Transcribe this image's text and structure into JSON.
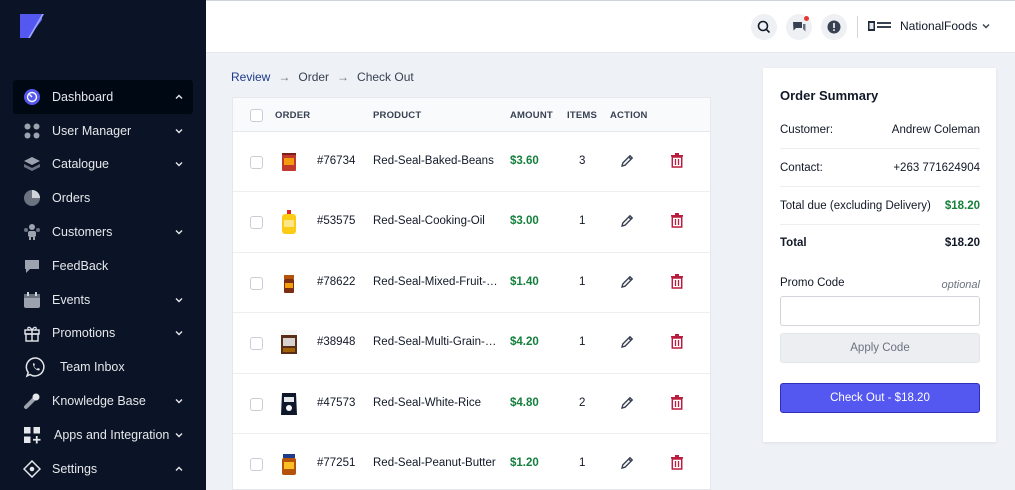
{
  "colors": {
    "sidebar_bg": "#0b1426",
    "accent": "#5457f0",
    "amount_green": "#15803d",
    "delete_red": "#b91c3c"
  },
  "sidebar": {
    "logo": "app-logo-icon",
    "items": [
      {
        "label": "Dashboard",
        "icon": "dashboard-icon",
        "chevron": "up",
        "active": true
      },
      {
        "label": "User Manager",
        "icon": "user-manager-icon",
        "chevron": "down"
      },
      {
        "label": "Catalogue",
        "icon": "catalogue-icon",
        "chevron": "down"
      },
      {
        "label": "Orders",
        "icon": "orders-icon",
        "chevron": ""
      },
      {
        "label": "Customers",
        "icon": "customers-icon",
        "chevron": "down"
      },
      {
        "label": "FeedBack",
        "icon": "feedback-icon",
        "chevron": ""
      },
      {
        "label": "Events",
        "icon": "events-icon",
        "chevron": "down"
      },
      {
        "label": "Promotions",
        "icon": "gift-icon",
        "chevron": "down"
      },
      {
        "label": "Team Inbox",
        "icon": "whatsapp-icon",
        "chevron": ""
      },
      {
        "label": "Knowledge Base",
        "icon": "knowledge-icon",
        "chevron": "down"
      },
      {
        "label": "Apps and Integration",
        "icon": "apps-icon",
        "chevron": "down"
      },
      {
        "label": "Settings",
        "icon": "settings-icon",
        "chevron": "up"
      }
    ]
  },
  "topbar": {
    "brand_name": "NationalFoods",
    "icons": [
      "search-icon",
      "chat-icon",
      "info-icon"
    ]
  },
  "breadcrumb": [
    "Review",
    "Order",
    "Check Out"
  ],
  "table": {
    "headers": {
      "order": "ORDER",
      "product": "PRODUCT",
      "amount": "AMOUNT",
      "items": "ITEMS",
      "action": "ACTION"
    },
    "rows": [
      {
        "order_id": "#76734",
        "product": "Red-Seal-Baked-Beans",
        "amount": "$3.60",
        "items": "3",
        "thumb": "baked-beans"
      },
      {
        "order_id": "#53575",
        "product": "Red-Seal-Cooking-Oil",
        "amount": "$3.00",
        "items": "1",
        "thumb": "cooking-oil"
      },
      {
        "order_id": "#78622",
        "product": "Red-Seal-Mixed-Fruit-Jam",
        "amount": "$1.40",
        "items": "1",
        "thumb": "jam"
      },
      {
        "order_id": "#38948",
        "product": "Red-Seal-Multi-Grain-Cereal",
        "amount": "$4.20",
        "items": "1",
        "thumb": "cereal"
      },
      {
        "order_id": "#47573",
        "product": "Red-Seal-White-Rice",
        "amount": "$4.80",
        "items": "2",
        "thumb": "rice"
      },
      {
        "order_id": "#77251",
        "product": "Red-Seal-Peanut-Butter",
        "amount": "$1.20",
        "items": "1",
        "thumb": "peanut-butter"
      }
    ]
  },
  "summary": {
    "title": "Order Summary",
    "customer_label": "Customer:",
    "customer_value": "Andrew Coleman",
    "contact_label": "Contact:",
    "contact_value": "+263 771624904",
    "due_label": "Total due (excluding Delivery)",
    "due_value": "$18.20",
    "total_label": "Total",
    "total_value": "$18.20",
    "promo_label": "Promo Code",
    "promo_optional": "optional",
    "promo_value": "",
    "apply_label": "Apply Code",
    "checkout_label": "Check Out - $18.20"
  }
}
